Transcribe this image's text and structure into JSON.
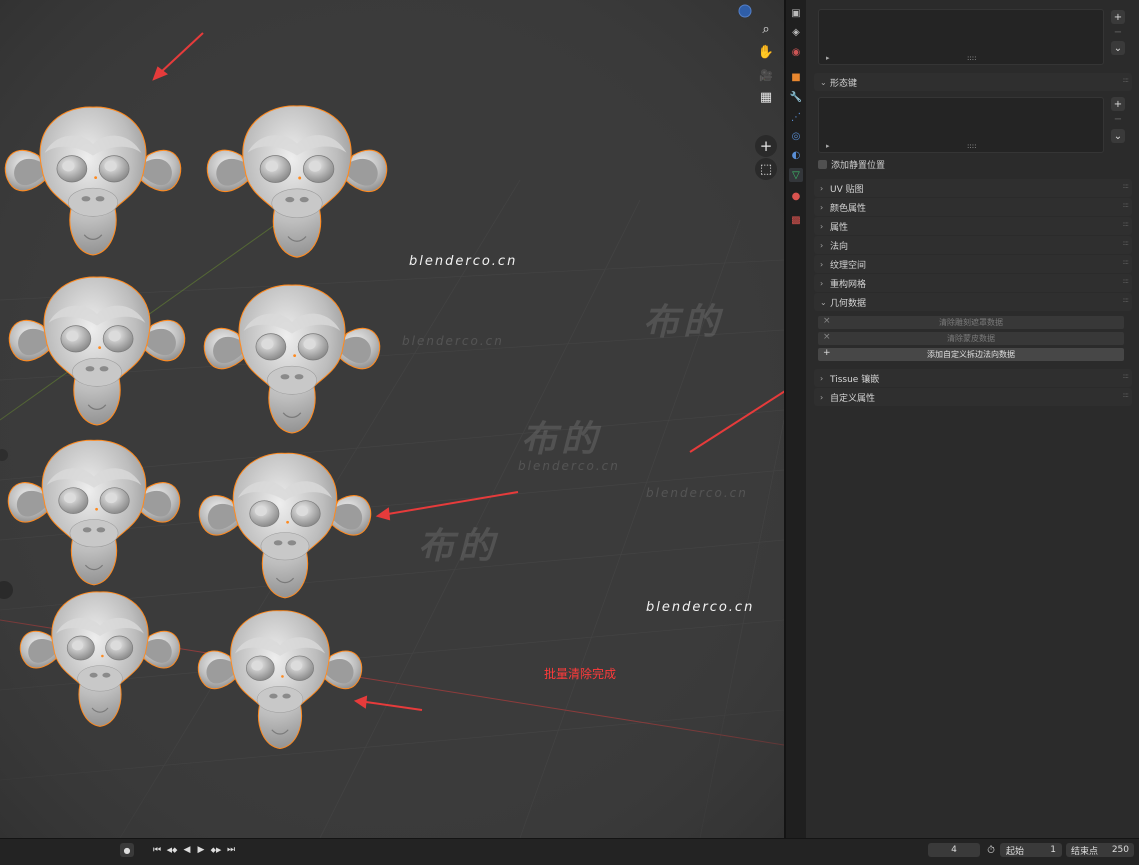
{
  "viewport": {
    "watermarks": {
      "url_main_1": "blenderco.cn",
      "url_main_2": "blenderco.cn",
      "url_faint_1": "blenderco.cn",
      "url_faint_2": "blenderco.cn",
      "url_faint_3": "blenderco.cn",
      "cn_1": "布的",
      "cn_2": "布的",
      "cn_3": "布的"
    },
    "annotation": "批量清除完成",
    "tools": {
      "zoom": "⌕",
      "pan": "✋",
      "camera": "🎥",
      "grid": "▦",
      "add": "+",
      "view": "⬚"
    },
    "accent_color": "#ff8a1f",
    "arrow_color": "#e63b3b"
  },
  "properties": {
    "list1": {
      "add": "+",
      "remove": "−",
      "expand": "⌄",
      "play": "▸",
      "grip": "::::"
    },
    "shape_keys": {
      "header": "形态键",
      "add": "+",
      "remove": "−",
      "expand": "⌄",
      "play": "▸",
      "grip": "::::",
      "relative_label": "添加静置位置"
    },
    "panels": [
      {
        "label": "UV 贴图",
        "chev": "›"
      },
      {
        "label": "颜色属性",
        "chev": "›"
      },
      {
        "label": "属性",
        "chev": "›"
      },
      {
        "label": "法向",
        "chev": "›"
      },
      {
        "label": "纹理空间",
        "chev": "›"
      },
      {
        "label": "重构网格",
        "chev": "›"
      },
      {
        "label": "几何数据",
        "chev": "⌄"
      }
    ],
    "geometry_buttons": [
      {
        "label": "清除雕刻遮罩数据",
        "icon": "×"
      },
      {
        "label": "清除蒙皮数据",
        "icon": "×"
      },
      {
        "label": "添加自定义拆边法向数据",
        "icon": "+"
      }
    ],
    "panels_after": [
      {
        "label": "Tissue 镶嵌",
        "chev": "›"
      },
      {
        "label": "自定义属性",
        "chev": "›"
      }
    ],
    "grip": "::::"
  },
  "timeline": {
    "record": "●",
    "jump_start": "⏮",
    "prev_key": "◀◆",
    "play_reverse": "◀",
    "play": "▶",
    "next_key": "◆▶",
    "jump_end": "⏭",
    "current_frame": "4",
    "start_label": "起始",
    "start_value": "1",
    "end_label": "结束点",
    "end_value": "250",
    "clock_icon": "⏱"
  }
}
